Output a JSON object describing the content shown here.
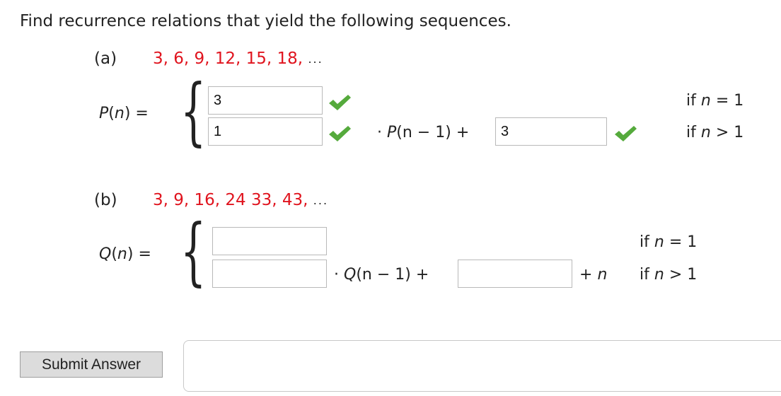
{
  "prompt": "Find recurrence relations that yield the following sequences.",
  "part_a": {
    "label": "(a)",
    "sequence": "3, 6, 9, 12, 15, 18,",
    "ellipsis": "...",
    "func_name": "P",
    "func_arg": "n",
    "equals": "=",
    "base_answer": "3",
    "coef_answer": "1",
    "dot": "·",
    "recur_func": "P",
    "recur_arg": "n − 1",
    "plus": "+",
    "const_answer": "3",
    "cond1_if": "if",
    "cond1_var": "n",
    "cond1_rel": "= 1",
    "cond2_if": "if",
    "cond2_var": "n",
    "cond2_rel": "> 1",
    "status": [
      "correct",
      "correct",
      "correct"
    ]
  },
  "part_b": {
    "label": "(b)",
    "sequence": "3, 9, 16, 24 33, 43,",
    "ellipsis": "...",
    "func_name": "Q",
    "func_arg": "n",
    "equals": "=",
    "base_answer": "",
    "coef_answer": "",
    "dot": "·",
    "recur_func": "Q",
    "recur_arg": "n − 1",
    "plus": "+",
    "const_answer": "",
    "tail_plus": "+",
    "tail_var": "n",
    "cond1_if": "if",
    "cond1_var": "n",
    "cond1_rel": "= 1",
    "cond2_if": "if",
    "cond2_var": "n",
    "cond2_rel": "> 1"
  },
  "submit_label": "Submit Answer",
  "colors": {
    "sequence": "#e0141e",
    "check": "#55aa3c"
  }
}
